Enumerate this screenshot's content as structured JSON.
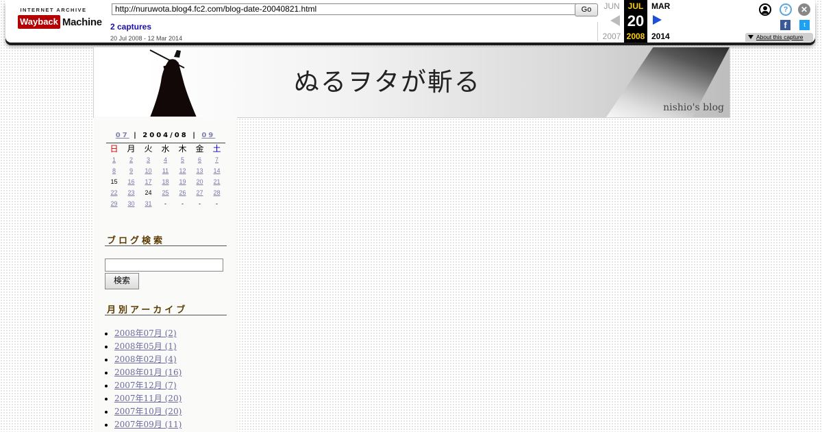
{
  "wayback": {
    "logo_top": "INTERNET ARCHIVE",
    "logo_left": "Wayback",
    "logo_right": "Machine",
    "url": "http://nuruwota.blog4.fc2.com/blog-date-20040821.html",
    "go_label": "Go",
    "captures": "2 captures",
    "range": "20 Jul 2008 - 12 Mar 2014",
    "prev": {
      "month": "JUN",
      "year": "2007"
    },
    "current": {
      "month": "JUL",
      "day": "20",
      "year": "2008"
    },
    "next": {
      "month": "MAR",
      "year": "2014"
    },
    "about": "About this capture",
    "icons": {
      "user": "user-icon",
      "help": "help-icon",
      "close": "close-icon",
      "facebook": "facebook-icon",
      "twitter": "twitter-icon"
    },
    "help_glyph": "?",
    "close_glyph": "✕",
    "fb_glyph": "f",
    "tw_glyph": "t"
  },
  "banner": {
    "title": "ぬるヲタが斬る",
    "subtitle": "nishio's blog"
  },
  "calendar": {
    "prev": "07",
    "sep": "|",
    "current": "2004/08",
    "next": "09",
    "weekdays": [
      "日",
      "月",
      "火",
      "水",
      "木",
      "金",
      "土"
    ],
    "weeks": [
      [
        {
          "t": "1",
          "link": true
        },
        {
          "t": "2",
          "link": true
        },
        {
          "t": "3",
          "link": true
        },
        {
          "t": "4",
          "link": true
        },
        {
          "t": "5",
          "link": true
        },
        {
          "t": "6",
          "link": true
        },
        {
          "t": "7",
          "link": true
        }
      ],
      [
        {
          "t": "8",
          "link": true
        },
        {
          "t": "9",
          "link": true
        },
        {
          "t": "10",
          "link": true
        },
        {
          "t": "11",
          "link": true
        },
        {
          "t": "12",
          "link": true
        },
        {
          "t": "13",
          "link": true
        },
        {
          "t": "14",
          "link": true
        }
      ],
      [
        {
          "t": "15",
          "link": false
        },
        {
          "t": "16",
          "link": true
        },
        {
          "t": "17",
          "link": true
        },
        {
          "t": "18",
          "link": true
        },
        {
          "t": "19",
          "link": true
        },
        {
          "t": "20",
          "link": true
        },
        {
          "t": "21",
          "link": true
        }
      ],
      [
        {
          "t": "22",
          "link": true
        },
        {
          "t": "23",
          "link": true
        },
        {
          "t": "24",
          "link": false
        },
        {
          "t": "25",
          "link": true
        },
        {
          "t": "26",
          "link": true
        },
        {
          "t": "27",
          "link": true
        },
        {
          "t": "28",
          "link": true
        }
      ],
      [
        {
          "t": "29",
          "link": true
        },
        {
          "t": "30",
          "link": true
        },
        {
          "t": "31",
          "link": true
        },
        {
          "t": "-",
          "link": false
        },
        {
          "t": "-",
          "link": false
        },
        {
          "t": "-",
          "link": false
        },
        {
          "t": "-",
          "link": false
        }
      ]
    ]
  },
  "sidebar": {
    "search_heading": "ブログ検索",
    "search_placeholder": "",
    "search_button": "検索",
    "archive_heading": "月別アーカイブ",
    "archives": [
      "2008年07月 (2)",
      "2008年05月 (1)",
      "2008年02月 (4)",
      "2008年01月 (16)",
      "2007年12月 (7)",
      "2007年11月 (20)",
      "2007年10月 (20)",
      "2007年09月 (11)"
    ]
  }
}
